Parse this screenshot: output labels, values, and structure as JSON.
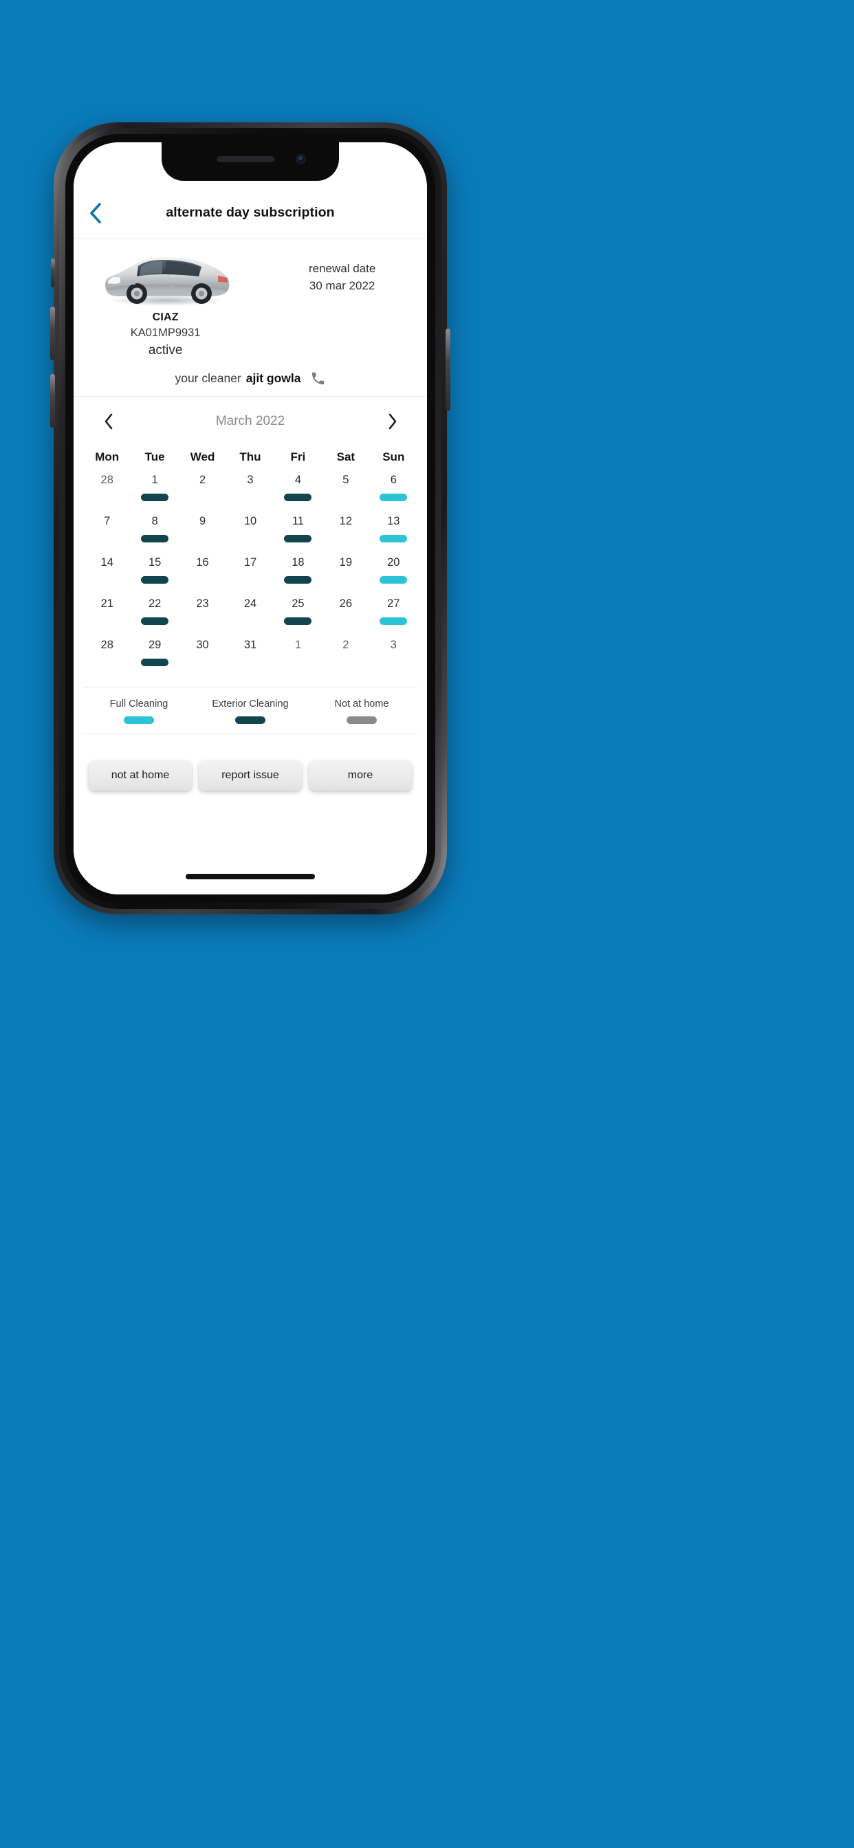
{
  "background_color": "#0A7BBA",
  "nav": {
    "back_icon": "chevron-left-icon",
    "back_icon_color": "#0C73AD",
    "title": "alternate day subscription"
  },
  "vehicle": {
    "image_alt": "silver sedan car",
    "name": "CIAZ",
    "plate": "KA01MP9931",
    "status": "active"
  },
  "renewal": {
    "label": "renewal date",
    "date": "30 mar 2022"
  },
  "cleaner": {
    "label": "your cleaner",
    "name": "ajit gowla",
    "call_icon": "phone-icon",
    "call_icon_color": "#7b7b7b"
  },
  "calendar": {
    "prev_icon": "chevron-left-icon",
    "next_icon": "chevron-right-icon",
    "month": "March 2022",
    "weekdays": [
      "Mon",
      "Tue",
      "Wed",
      "Thu",
      "Fri",
      "Sat",
      "Sun"
    ],
    "colors": {
      "full_cleaning": "#2CC3D6",
      "exterior_cleaning": "#13454F",
      "not_at_home": "#8A8A8A",
      "none": "none"
    },
    "days": [
      {
        "num": "28",
        "type": "none",
        "muted": true
      },
      {
        "num": "1",
        "type": "exterior",
        "muted": false
      },
      {
        "num": "2",
        "type": "none",
        "muted": false
      },
      {
        "num": "3",
        "type": "none",
        "muted": false
      },
      {
        "num": "4",
        "type": "exterior",
        "muted": false
      },
      {
        "num": "5",
        "type": "none",
        "muted": false
      },
      {
        "num": "6",
        "type": "full",
        "muted": false
      },
      {
        "num": "7",
        "type": "none",
        "muted": false
      },
      {
        "num": "8",
        "type": "exterior",
        "muted": false
      },
      {
        "num": "9",
        "type": "none",
        "muted": false
      },
      {
        "num": "10",
        "type": "none",
        "muted": false
      },
      {
        "num": "11",
        "type": "exterior",
        "muted": false
      },
      {
        "num": "12",
        "type": "none",
        "muted": false
      },
      {
        "num": "13",
        "type": "full",
        "muted": false
      },
      {
        "num": "14",
        "type": "none",
        "muted": false
      },
      {
        "num": "15",
        "type": "exterior",
        "muted": false
      },
      {
        "num": "16",
        "type": "none",
        "muted": false
      },
      {
        "num": "17",
        "type": "none",
        "muted": false
      },
      {
        "num": "18",
        "type": "exterior",
        "muted": false
      },
      {
        "num": "19",
        "type": "none",
        "muted": false
      },
      {
        "num": "20",
        "type": "full",
        "muted": false
      },
      {
        "num": "21",
        "type": "none",
        "muted": false
      },
      {
        "num": "22",
        "type": "exterior",
        "muted": false
      },
      {
        "num": "23",
        "type": "none",
        "muted": false
      },
      {
        "num": "24",
        "type": "none",
        "muted": false
      },
      {
        "num": "25",
        "type": "exterior",
        "muted": false
      },
      {
        "num": "26",
        "type": "none",
        "muted": false
      },
      {
        "num": "27",
        "type": "full",
        "muted": false
      },
      {
        "num": "28",
        "type": "none",
        "muted": false
      },
      {
        "num": "29",
        "type": "exterior",
        "muted": false
      },
      {
        "num": "30",
        "type": "none",
        "muted": false
      },
      {
        "num": "31",
        "type": "none",
        "muted": false
      },
      {
        "num": "1",
        "type": "none",
        "muted": true
      },
      {
        "num": "2",
        "type": "none",
        "muted": true
      },
      {
        "num": "3",
        "type": "none",
        "muted": true
      }
    ]
  },
  "legend": [
    {
      "label": "Full Cleaning",
      "color": "#2CC3D6"
    },
    {
      "label": "Exterior Cleaning",
      "color": "#13454F"
    },
    {
      "label": "Not at home",
      "color": "#8A8A8A"
    }
  ],
  "actions": [
    {
      "label": "not at home"
    },
    {
      "label": "report issue"
    },
    {
      "label": "more"
    }
  ]
}
